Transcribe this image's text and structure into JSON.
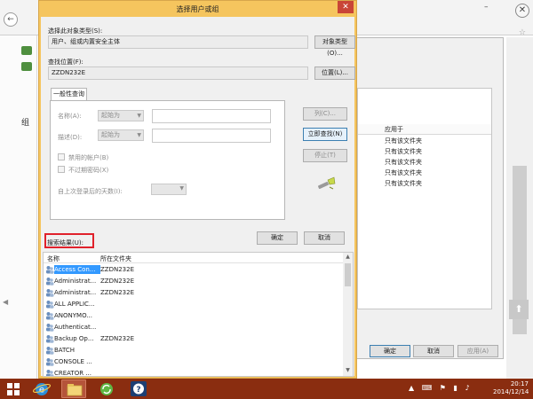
{
  "dialog": {
    "title": "选择用户或组",
    "close_glyph": "✕",
    "object_type_label": "选择此对象类型(S):",
    "object_type_value": "用户、组或内置安全主体",
    "object_type_button": "对象类型(O)...",
    "location_label": "查找位置(F):",
    "location_value": "ZZDN232E",
    "location_button": "位置(L)...",
    "tab_label": "一般性查询",
    "name_label": "名称(A):",
    "name_combo": "起始为",
    "desc_label": "描述(D):",
    "desc_combo": "起始为",
    "disabled_accounts": "禁用的帐户(B)",
    "no_expire_pwd": "不过期密码(X)",
    "days_since_logon": "自上次登录后的天数(I):",
    "columns_button": "列(C)...",
    "find_now_button": "立即查找(N)",
    "stop_button": "停止(T)",
    "ok_button": "确定",
    "cancel_button": "取消",
    "results_label": "搜索结果(U):",
    "results_columns": [
      "名称",
      "所在文件夹"
    ],
    "results": [
      {
        "name": "Access Con...",
        "folder": "ZZDN232E",
        "selected": true
      },
      {
        "name": "Administrat...",
        "folder": "ZZDN232E"
      },
      {
        "name": "Administrat...",
        "folder": "ZZDN232E"
      },
      {
        "name": "ALL APPLIC...",
        "folder": ""
      },
      {
        "name": "ANONYMO...",
        "folder": ""
      },
      {
        "name": "Authenticat...",
        "folder": ""
      },
      {
        "name": "Backup Op...",
        "folder": "ZZDN232E"
      },
      {
        "name": "BATCH",
        "folder": ""
      },
      {
        "name": "CONSOLE ...",
        "folder": ""
      },
      {
        "name": "CREATOR ...",
        "folder": ""
      }
    ]
  },
  "background_dialog": {
    "column_header": "应用于",
    "rows": [
      "只有该文件夹",
      "只有该文件夹",
      "只有该文件夹",
      "只有该文件夹",
      "只有该文件夹"
    ],
    "ok_button": "确定",
    "cancel_button": "取消",
    "apply_button": "应用(A)"
  },
  "background_window": {
    "left_char": "组"
  },
  "taskbar": {
    "time": "20:17",
    "date": "2014/12/14"
  },
  "colors": {
    "dialog_title_bar": "#f5c55e",
    "highlight_box": "#e0212b",
    "selection": "#3399ff",
    "taskbar": "#8a2d10"
  }
}
